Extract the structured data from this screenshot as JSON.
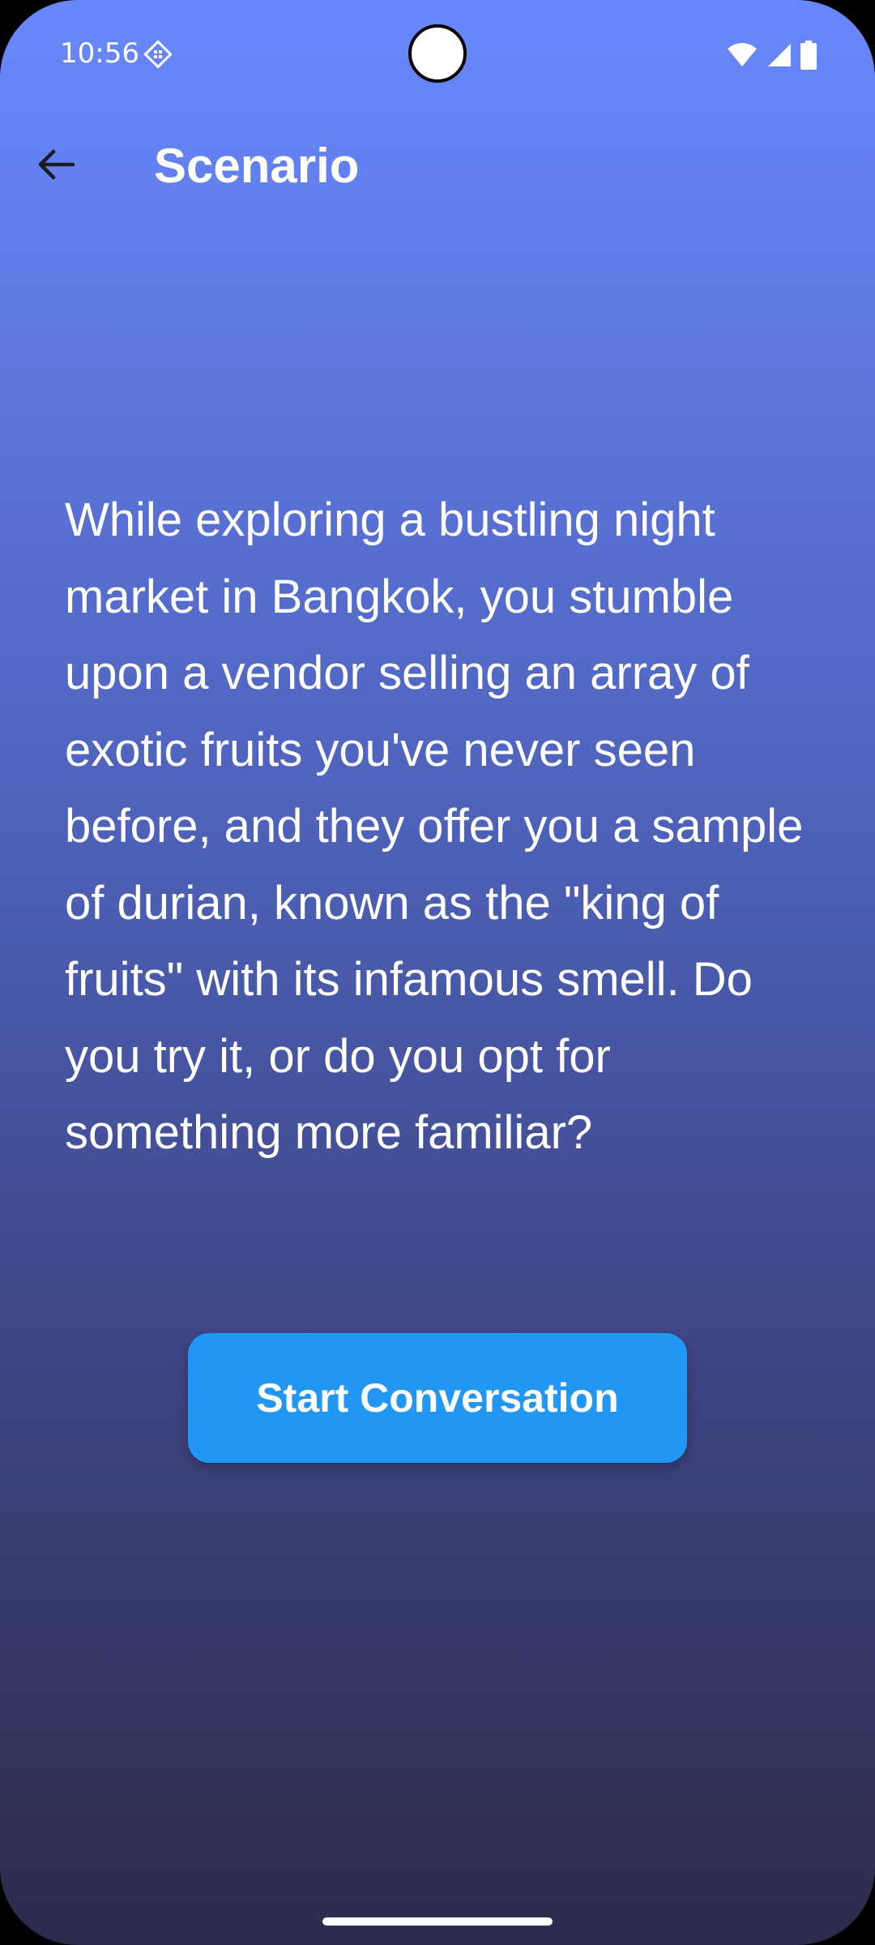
{
  "status_bar": {
    "time": "10:56",
    "icons": [
      "notification-app-icon",
      "wifi-icon",
      "signal-icon",
      "battery-icon"
    ]
  },
  "app_bar": {
    "back_icon": "arrow-left-icon",
    "title": "Scenario"
  },
  "scenario": {
    "text": "While exploring a bustling night market in Bangkok, you stumble upon a vendor selling an array of exotic fruits you've never seen before, and they offer you a sample of durian, known as the \"king of fruits\" with its infamous smell. Do you try it, or do you opt for something more familiar?"
  },
  "actions": {
    "start_label": "Start Conversation"
  },
  "colors": {
    "gradient_top": "#6788fc",
    "gradient_bottom": "#2d2b4c",
    "button": "#2196f3",
    "text": "#ffffff",
    "back_arrow": "#1c1b1f"
  }
}
